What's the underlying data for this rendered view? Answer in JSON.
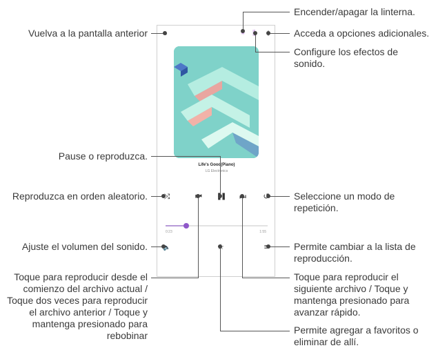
{
  "callouts": {
    "back": "Vuelva a la pantalla anterior",
    "flashlight": "Encender/apagar la linterna.",
    "options": "Acceda a opciones adicionales.",
    "sound_effects": "Configure los efectos de sonido.",
    "pause_play": "Pause o reproduzca.",
    "shuffle": "Reproduzca en orden aleatorio.",
    "repeat": "Seleccione un modo de repetición.",
    "volume": "Ajuste el volumen del sonido.",
    "playlist": "Permite cambiar a la lista de reproducción.",
    "previous": "Toque para reproducir desde el comienzo del archivo actual / Toque dos veces para reproducir el archivo anterior / Toque y mantenga presionado para rebobinar",
    "next": "Toque para reproducir el siguiente archivo / Toque y mantenga presionado para avanzar rápido.",
    "favorite": "Permite agregar a favoritos o eliminar de allí."
  },
  "player": {
    "song_title": "Life's Good(Piano)",
    "artist": "LG Electronics",
    "time_elapsed": "0:23",
    "time_total": "1:55",
    "progress": 0.2
  },
  "icons": {
    "back": "⌄",
    "flashlight": "✴",
    "equalizer": "⫼",
    "more": "⋮",
    "shuffle": "⤨",
    "previous": "⏮",
    "pause": "❚❚",
    "next": "⏭",
    "repeat": "↺",
    "volume": "🔈",
    "favorite": "☆",
    "playlist": "≡"
  },
  "colors": {
    "art_background": "#7fd2c9",
    "progress_knob": "#8f58c9"
  }
}
